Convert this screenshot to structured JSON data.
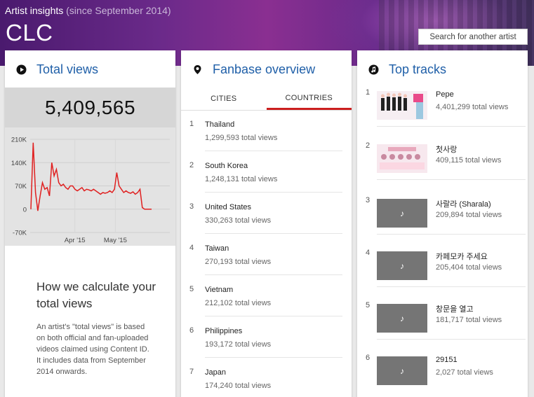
{
  "header": {
    "subtitle": "Artist insights",
    "since": "(since September 2014)",
    "artist": "CLC",
    "search_label": "Search for another artist"
  },
  "total_views": {
    "title": "Total views",
    "count": "5,409,565",
    "calc_title": "How we calculate your total views",
    "calc_text": "An artist's \"total views\" is based on both official and fan-uploaded videos claimed using Content ID. It includes data from September 2014 onwards."
  },
  "chart_data": {
    "type": "line",
    "ylim": [
      -70000,
      210000
    ],
    "y_ticks": [
      "210K",
      "140K",
      "70K",
      "0",
      "-70K"
    ],
    "x_ticks": [
      "Apr '15",
      "May '15"
    ],
    "grid": true,
    "color": "#e02020",
    "series": [
      {
        "values": [
          0,
          200000,
          50000,
          -5000,
          40000,
          80000,
          60000,
          65000,
          40000,
          140000,
          100000,
          120000,
          80000,
          70000,
          75000,
          65000,
          60000,
          70000,
          70000,
          60000,
          55000,
          60000,
          65000,
          55000,
          60000,
          58000,
          55000,
          60000,
          55000,
          50000,
          45000,
          50000,
          48000,
          50000,
          55000,
          50000,
          60000,
          110000,
          70000,
          60000,
          50000,
          55000,
          50000,
          48000,
          52000,
          45000,
          50000,
          60000,
          5000,
          0,
          0,
          0,
          0
        ]
      }
    ]
  },
  "fanbase": {
    "title": "Fanbase overview",
    "tabs": [
      "CITIES",
      "COUNTRIES"
    ],
    "countries": [
      {
        "rank": "1",
        "name": "Thailand",
        "views": "1,299,593 total views"
      },
      {
        "rank": "2",
        "name": "South Korea",
        "views": "1,248,131 total views"
      },
      {
        "rank": "3",
        "name": "United States",
        "views": "330,263 total views"
      },
      {
        "rank": "4",
        "name": "Taiwan",
        "views": "270,193 total views"
      },
      {
        "rank": "5",
        "name": "Vietnam",
        "views": "212,102 total views"
      },
      {
        "rank": "6",
        "name": "Philippines",
        "views": "193,172 total views"
      },
      {
        "rank": "7",
        "name": "Japan",
        "views": "174,240 total views"
      }
    ]
  },
  "tracks": {
    "title": "Top tracks",
    "items": [
      {
        "rank": "1",
        "name": "Pepe",
        "views": "4,401,299 total views"
      },
      {
        "rank": "2",
        "name": "첫사랑",
        "views": "409,115 total views"
      },
      {
        "rank": "3",
        "name": "사랄라 (Sharala)",
        "views": "209,894 total views"
      },
      {
        "rank": "4",
        "name": "카페모카 주세요",
        "views": "205,404 total views"
      },
      {
        "rank": "5",
        "name": "창문을 열고",
        "views": "181,717 total views"
      },
      {
        "rank": "6",
        "name": "29151",
        "views": "2,027 total views"
      }
    ]
  }
}
